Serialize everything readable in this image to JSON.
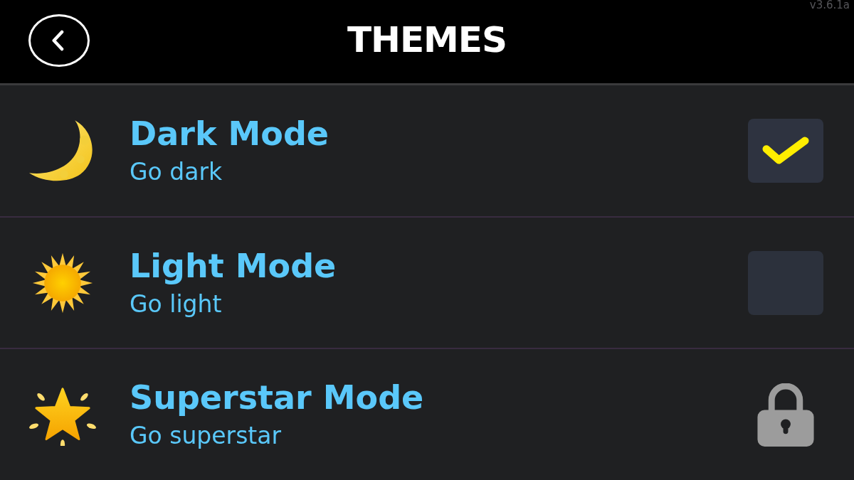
{
  "header": {
    "title": "THEMES",
    "version": "v3.6.1a"
  },
  "themes": [
    {
      "title": "Dark Mode",
      "subtitle": "Go dark",
      "kind": "checkbox",
      "checked": true
    },
    {
      "title": "Light Mode",
      "subtitle": "Go light",
      "kind": "checkbox",
      "checked": false
    },
    {
      "title": "Superstar Mode",
      "subtitle": "Go superstar",
      "kind": "lock"
    }
  ]
}
